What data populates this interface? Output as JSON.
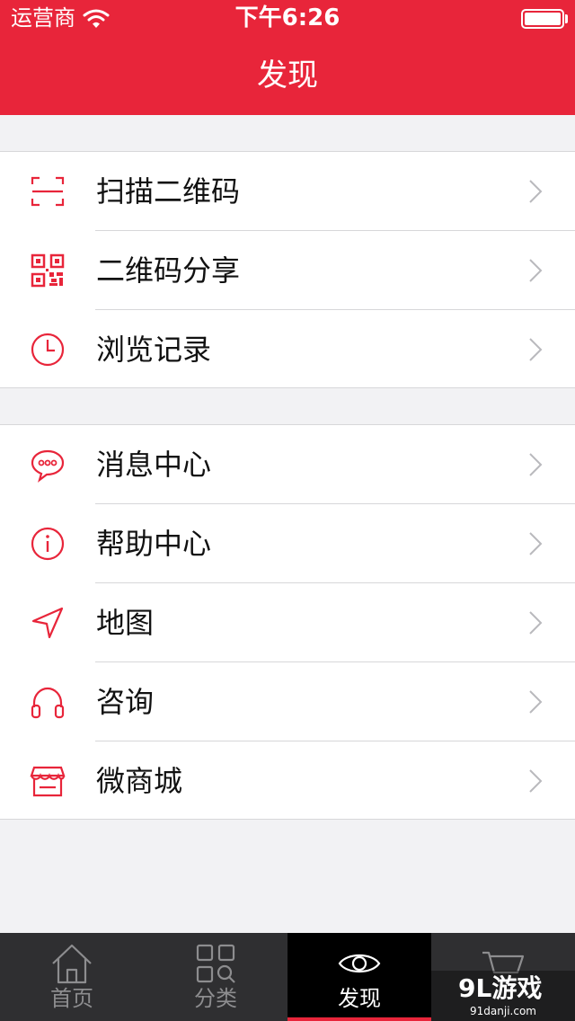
{
  "status_bar": {
    "carrier": "运营商",
    "time": "下午6:26",
    "battery_level": 1.0
  },
  "nav": {
    "title": "发现"
  },
  "groups": [
    {
      "items": [
        {
          "label": "扫描二维码",
          "icon": "scan-icon"
        },
        {
          "label": "二维码分享",
          "icon": "qr-code-icon"
        },
        {
          "label": "浏览记录",
          "icon": "clock-icon"
        }
      ]
    },
    {
      "items": [
        {
          "label": "消息中心",
          "icon": "chat-bubble-icon"
        },
        {
          "label": "帮助中心",
          "icon": "info-icon"
        },
        {
          "label": "地图",
          "icon": "location-arrow-icon"
        },
        {
          "label": "咨询",
          "icon": "headphones-icon"
        },
        {
          "label": "微商城",
          "icon": "store-icon"
        }
      ]
    }
  ],
  "tabbar": {
    "tabs": [
      {
        "label": "首页",
        "icon": "home-icon",
        "active": false
      },
      {
        "label": "分类",
        "icon": "category-search-icon",
        "active": false
      },
      {
        "label": "发现",
        "icon": "eye-icon",
        "active": true
      },
      {
        "label": "",
        "icon": "cart-icon",
        "active": false
      }
    ]
  },
  "watermark": {
    "logo": "9L游戏",
    "url": "91danji.com"
  },
  "colors": {
    "accent": "#e8253a",
    "tabbar_bg": "#2f2f31",
    "active_tab_bg": "#000000",
    "page_bg": "#f2f2f4"
  }
}
